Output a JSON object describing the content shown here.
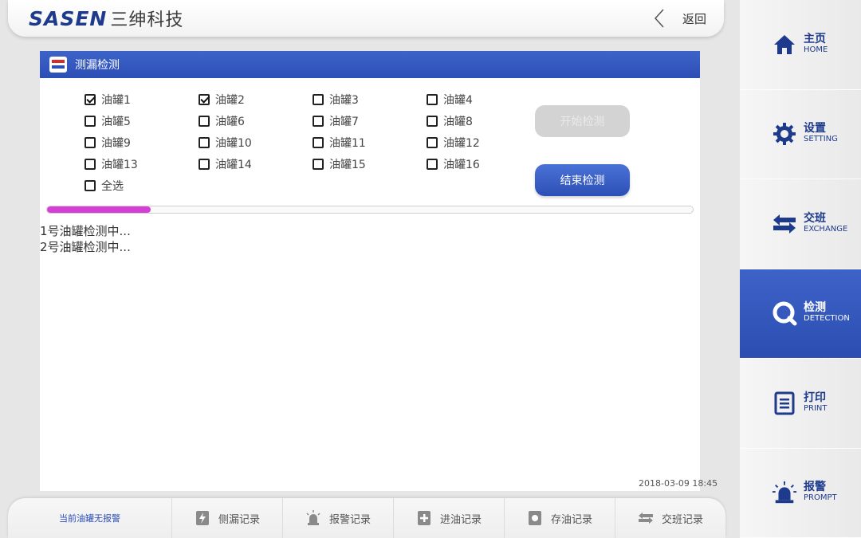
{
  "header": {
    "logo_text": "SASEN",
    "logo_cn": "三绅科技",
    "back_label": "返回"
  },
  "panel": {
    "title": "测漏检测",
    "tanks": [
      {
        "label": "油罐1",
        "checked": true
      },
      {
        "label": "油罐2",
        "checked": true
      },
      {
        "label": "油罐3",
        "checked": false
      },
      {
        "label": "油罐4",
        "checked": false
      },
      {
        "label": "油罐5",
        "checked": false
      },
      {
        "label": "油罐6",
        "checked": false
      },
      {
        "label": "油罐7",
        "checked": false
      },
      {
        "label": "油罐8",
        "checked": false
      },
      {
        "label": "油罐9",
        "checked": false
      },
      {
        "label": "油罐10",
        "checked": false
      },
      {
        "label": "油罐11",
        "checked": false
      },
      {
        "label": "油罐12",
        "checked": false
      },
      {
        "label": "油罐13",
        "checked": false
      },
      {
        "label": "油罐14",
        "checked": false
      },
      {
        "label": "油罐15",
        "checked": false
      },
      {
        "label": "油罐16",
        "checked": false
      }
    ],
    "select_all": {
      "label": "全选",
      "checked": false
    },
    "start_button": "开始检测",
    "stop_button": "结束检测",
    "progress_fraction": 0.16,
    "log_lines": [
      "1号油罐检测中...",
      "2号油罐检测中..."
    ],
    "timestamp": "2018-03-09 18:45"
  },
  "sidebar": {
    "items": [
      {
        "cn": "主页",
        "en": "HOME",
        "icon": "home-icon",
        "active": false
      },
      {
        "cn": "设置",
        "en": "SETTING",
        "icon": "gear-icon",
        "active": false
      },
      {
        "cn": "交班",
        "en": "EXCHANGE",
        "icon": "exchange-icon",
        "active": false
      },
      {
        "cn": "检测",
        "en": "DETECTION",
        "icon": "detection-icon",
        "active": true
      },
      {
        "cn": "打印",
        "en": "PRINT",
        "icon": "print-icon",
        "active": false
      },
      {
        "cn": "报警",
        "en": "PROMPT",
        "icon": "alarm-icon",
        "active": false
      }
    ]
  },
  "bottom": {
    "status": "当前油罐无报警",
    "tabs": [
      {
        "label": "侧漏记录",
        "icon": "leak-record-icon"
      },
      {
        "label": "报警记录",
        "icon": "alarm-record-icon"
      },
      {
        "label": "进油记录",
        "icon": "inflow-record-icon"
      },
      {
        "label": "存油记录",
        "icon": "storage-record-icon"
      },
      {
        "label": "交班记录",
        "icon": "exchange-record-icon"
      }
    ]
  },
  "colors": {
    "brand_blue": "#2c4fb6",
    "brand_red": "#d52b2b",
    "progress": "#d63fd6"
  }
}
